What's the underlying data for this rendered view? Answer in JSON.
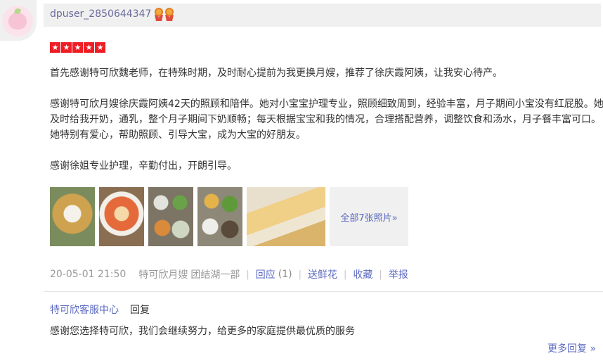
{
  "user": {
    "name": "dpuser_2850644347",
    "medal_icons": [
      "medal-icon",
      "medal-icon"
    ]
  },
  "rating": {
    "stars": 5,
    "max": 5,
    "star_color": "#ee1d24"
  },
  "review": {
    "paragraphs": [
      "首先感谢特可欣魏老师，在特殊时期，及时耐心提前为我更换月嫂，推荐了徐庆霞阿姨，让我安心待产。",
      "感谢特可欣月嫂徐庆霞阿姨42天的照顾和陪伴。她对小宝宝护理专业，照顾细致周到，经验丰富，月子期间小宝没有红屁股。她及时给我开奶，通乳，整个月子期间下奶顺畅；每天根据宝宝和我的情况，合理搭配营养，调整饮食和汤水，月子餐丰富可口。她特别有爱心，帮助照顾、引导大宝，成为大宝的好朋友。",
      "感谢徐姐专业护理，辛勤付出，开朗引导。"
    ]
  },
  "photos": {
    "thumbnails": [
      "pancake-and-egg-photo",
      "soup-bowl-photo",
      "meal-dishes-photo",
      "meal-dishes-photo",
      "toast-plate-photo"
    ],
    "more_label": "全部7张照片»"
  },
  "meta": {
    "date": "20-05-01 21:50",
    "nanny": "特可欣月嫂",
    "branch": "团结湖一部",
    "reply_label": "回应",
    "reply_count": "(1)",
    "flower_label": "送鲜花",
    "favorite_label": "收藏",
    "report_label": "举报"
  },
  "reply": {
    "shop_name": "特可欣客服中心",
    "verb": "回复",
    "text": "感谢您选择特可欣，我们会继续努力，给更多的家庭提供最优质的服务",
    "more_label": "更多回复 »"
  },
  "colors": {
    "link": "#5b6abf",
    "meta": "#999999",
    "text": "#333333",
    "header_bg": "#f0f0f0"
  }
}
